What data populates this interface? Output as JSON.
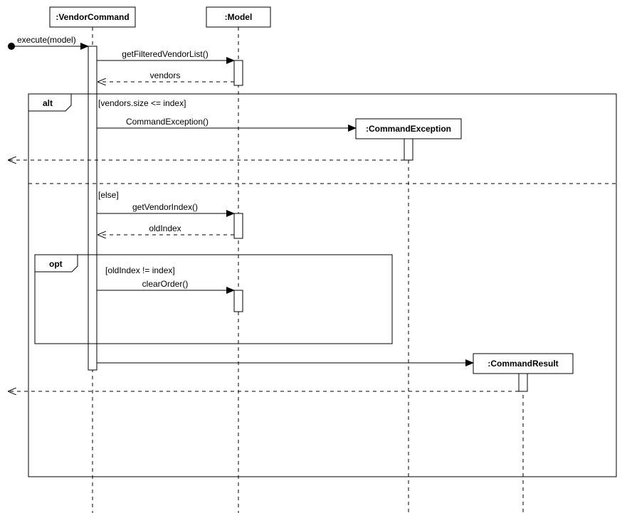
{
  "participants": {
    "vendorCommand": ":VendorCommand",
    "model": ":Model",
    "commandException": ":CommandException",
    "commandResult": ":CommandResult"
  },
  "messages": {
    "execute": "execute(model)",
    "getFilteredVendorList": "getFilteredVendorList()",
    "vendors": "vendors",
    "commandException": "CommandException()",
    "getVendorIndex": "getVendorIndex()",
    "oldIndex": "oldIndex",
    "clearOrder": "clearOrder()"
  },
  "fragments": {
    "alt": "alt",
    "opt": "opt"
  },
  "guards": {
    "sizeCheck": "[vendors.size <= index]",
    "elseGuard": "[else]",
    "oldIndexCheck": "[oldIndex != index]"
  }
}
